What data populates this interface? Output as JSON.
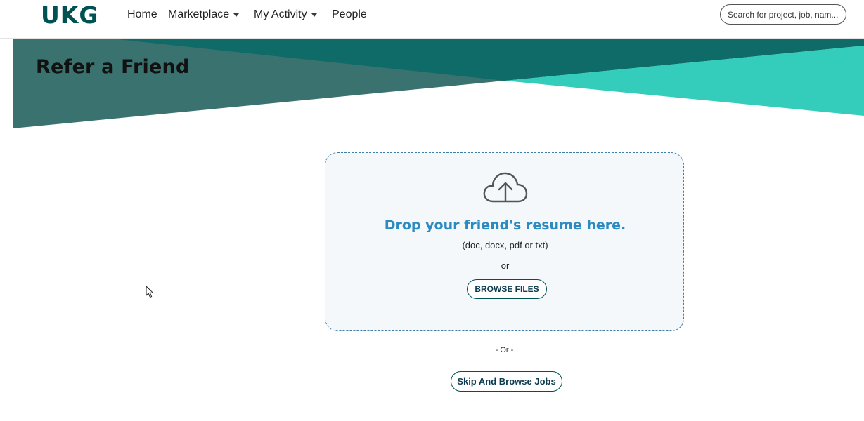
{
  "header": {
    "logo_text": "UKG",
    "nav": [
      {
        "label": "Home",
        "has_dropdown": false
      },
      {
        "label": "Marketplace",
        "has_dropdown": true
      },
      {
        "label": "My Activity",
        "has_dropdown": true
      },
      {
        "label": "People",
        "has_dropdown": false
      }
    ],
    "search_placeholder": "Search for project, job, nam..."
  },
  "banner": {
    "title": "Refer a Friend",
    "colors": {
      "dark": "#0f6b67",
      "mid": "#3a726f",
      "light": "#34cdbb"
    }
  },
  "upload": {
    "icon": "cloud-upload-icon",
    "heading": "Drop your friend's resume here.",
    "formats": "(doc, docx, pdf or txt)",
    "or_text": "or",
    "browse_label": "BROWSE FILES"
  },
  "separator_text": "- Or -",
  "skip_label": "Skip And Browse Jobs",
  "colors": {
    "accent": "#2c8ac0",
    "brand": "#005151",
    "button_text": "#0b3b4f"
  }
}
